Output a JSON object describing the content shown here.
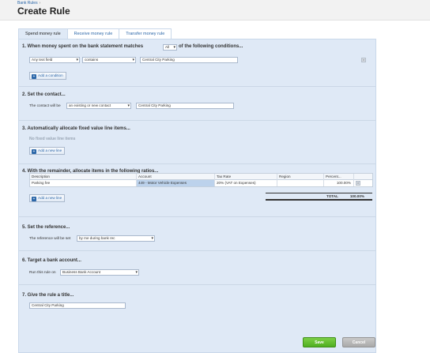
{
  "breadcrumb": {
    "link": "Bank Rules",
    "separator": "›"
  },
  "page_title": "Create Rule",
  "tabs": [
    {
      "label": "Spend money rule",
      "active": true
    },
    {
      "label": "Receive money rule",
      "active": false
    },
    {
      "label": "Transfer money rule",
      "active": false
    }
  ],
  "section1": {
    "title_pre": "1. When money spent on the bank statement matches",
    "match_value": "All",
    "title_post": "of the following conditions...",
    "field_value": "Any text field",
    "operator_value": "contains",
    "condition_text": "Central City Parking",
    "add_label": "Add a condition"
  },
  "section2": {
    "title": "2. Set the contact...",
    "prefix": "The contact will be",
    "mode_value": "an existing or new contact",
    "contact_value": "Central City Parking"
  },
  "section3": {
    "title": "3. Automatically allocate fixed value line items...",
    "empty_text": "No fixed value line items",
    "add_label": "Add a new line"
  },
  "section4": {
    "title": "4. With the remainder, allocate items in the following ratios...",
    "columns": {
      "description": "Description",
      "account": "Account",
      "tax": "Tax Rate",
      "region": "Region",
      "percent": "Percent..."
    },
    "row": {
      "description": "Parking fee",
      "account": "449 - Motor Vehicle Expenses",
      "tax": "20% (VAT on Expenses)",
      "region": "",
      "percent": "100.00%"
    },
    "add_label": "Add a new line",
    "total_label": "TOTAL",
    "total_value": "100.00%"
  },
  "section5": {
    "title": "5. Set the reference...",
    "prefix": "The reference will be set",
    "value": "by me during bank rec"
  },
  "section6": {
    "title": "6. Target a bank account...",
    "prefix": "Run this rule on",
    "value": "Business Bank Account"
  },
  "section7": {
    "title": "7. Give the rule a title...",
    "value": "Central City Parking"
  },
  "footer": {
    "save_label": "Save",
    "cancel_label": "Cancel"
  },
  "colors": {
    "accent": "#2a66a8",
    "panel": "#dfe9f6",
    "save": "#5cb82a",
    "cancel": "#b3b3b3"
  }
}
